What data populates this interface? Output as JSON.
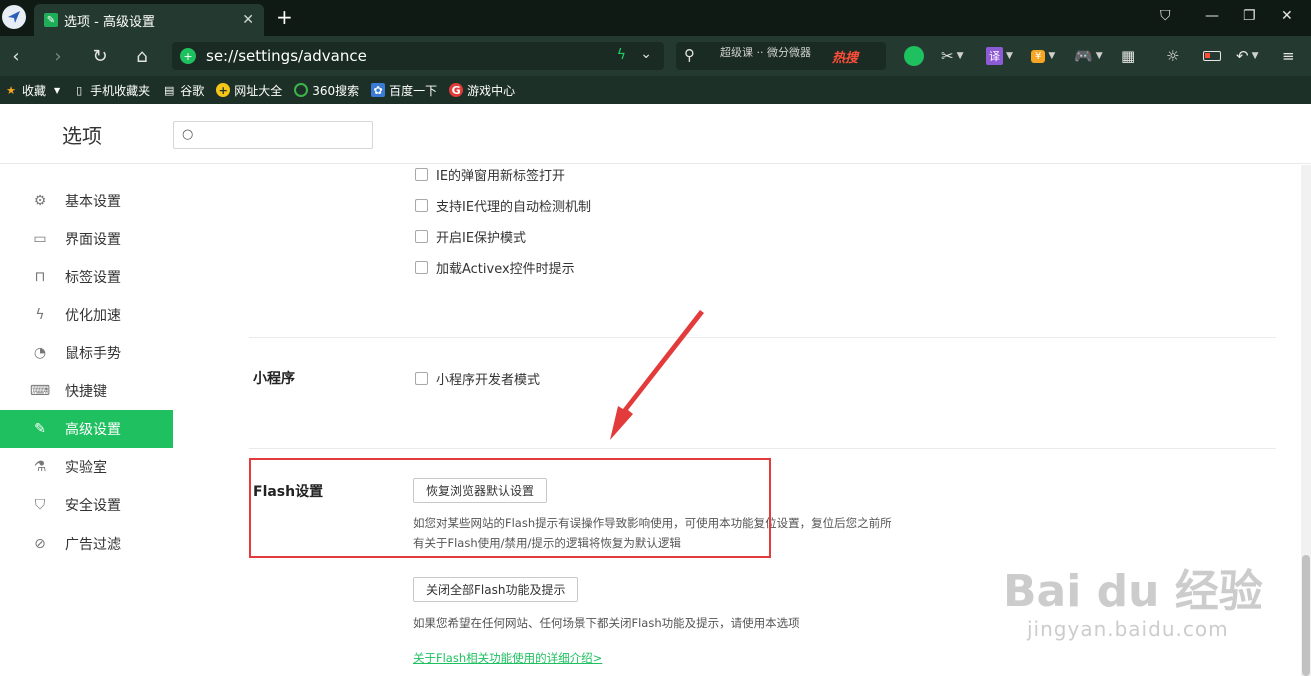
{
  "tab": {
    "title": "选项 - 高级设置"
  },
  "address": {
    "url": "se://settings/advance"
  },
  "search_bar": {
    "hint": "超级课 ·· 微分微器",
    "hot": "热搜"
  },
  "toolbar_icons": [
    "book-icon",
    "scissors-icon",
    "translate-icon",
    "shield-coin-icon",
    "game-icon",
    "grid-icon",
    "brightness-icon",
    "battery-icon",
    "undo-icon",
    "menu-icon"
  ],
  "toolbar_glyphs": {
    "translate": "译",
    "coin": "¥"
  },
  "bookmarks": [
    {
      "label": "收藏",
      "icon": "star-icon",
      "color": "#f5a623"
    },
    {
      "label": "手机收藏夹",
      "icon": "phone-icon",
      "color": "#ffffff"
    },
    {
      "label": "谷歌",
      "icon": "page-icon",
      "color": "#ffffff"
    },
    {
      "label": "网址大全",
      "icon": "plus-icon",
      "color": "#f5c518"
    },
    {
      "label": "360搜索",
      "icon": "search360-icon",
      "color": "#3bb54a"
    },
    {
      "label": "百度一下",
      "icon": "paw-icon",
      "color": "#3a7bd5"
    },
    {
      "label": "游戏中心",
      "icon": "game-center-icon",
      "color": "#e23b3b"
    }
  ],
  "page": {
    "title": "选项",
    "search_placeholder": ""
  },
  "sidebar": {
    "items": [
      {
        "label": "基本设置",
        "icon": "gear-icon",
        "glyph": "⚙"
      },
      {
        "label": "界面设置",
        "icon": "window-icon",
        "glyph": "▭"
      },
      {
        "label": "标签设置",
        "icon": "tab-icon",
        "glyph": "⊓"
      },
      {
        "label": "优化加速",
        "icon": "lightning-icon",
        "glyph": "ϟ"
      },
      {
        "label": "鼠标手势",
        "icon": "mouse-icon",
        "glyph": "◔"
      },
      {
        "label": "快捷键",
        "icon": "keyboard-icon",
        "glyph": "⌨"
      },
      {
        "label": "高级设置",
        "icon": "wrench-icon",
        "glyph": "🔧",
        "active": true
      },
      {
        "label": "实验室",
        "icon": "flask-icon",
        "glyph": "⚗"
      },
      {
        "label": "安全设置",
        "icon": "shield-icon",
        "glyph": "⛉"
      },
      {
        "label": "广告过滤",
        "icon": "block-icon",
        "glyph": "⊘"
      }
    ]
  },
  "ie_options": [
    "IE的弹窗用新标签打开",
    "支持IE代理的自动检测机制",
    "开启IE保护模式",
    "加载Activex控件时提示"
  ],
  "mini_program": {
    "label": "小程序",
    "option": "小程序开发者模式"
  },
  "flash": {
    "label": "Flash设置",
    "restore_button": "恢复浏览器默认设置",
    "restore_desc_1": "如您对某些网站的Flash提示有误操作导致影响使用，可使用本功能复位设置，复位后您之前所",
    "restore_desc_2": "有关于Flash使用/禁用/提示的逻辑将恢复为默认逻辑",
    "disable_button": "关闭全部Flash功能及提示",
    "disable_desc": "如果您希望在任何网站、任何场景下都关闭Flash功能及提示，请使用本选项",
    "more_link": "关于Flash相关功能使用的详细介绍>"
  },
  "watermark": {
    "main": "Bai  du 经验",
    "sub": "jingyan.baidu.com"
  },
  "colors": {
    "accent": "#1fc060",
    "annotation": "#e33b3b",
    "chrome": "#243a30"
  }
}
